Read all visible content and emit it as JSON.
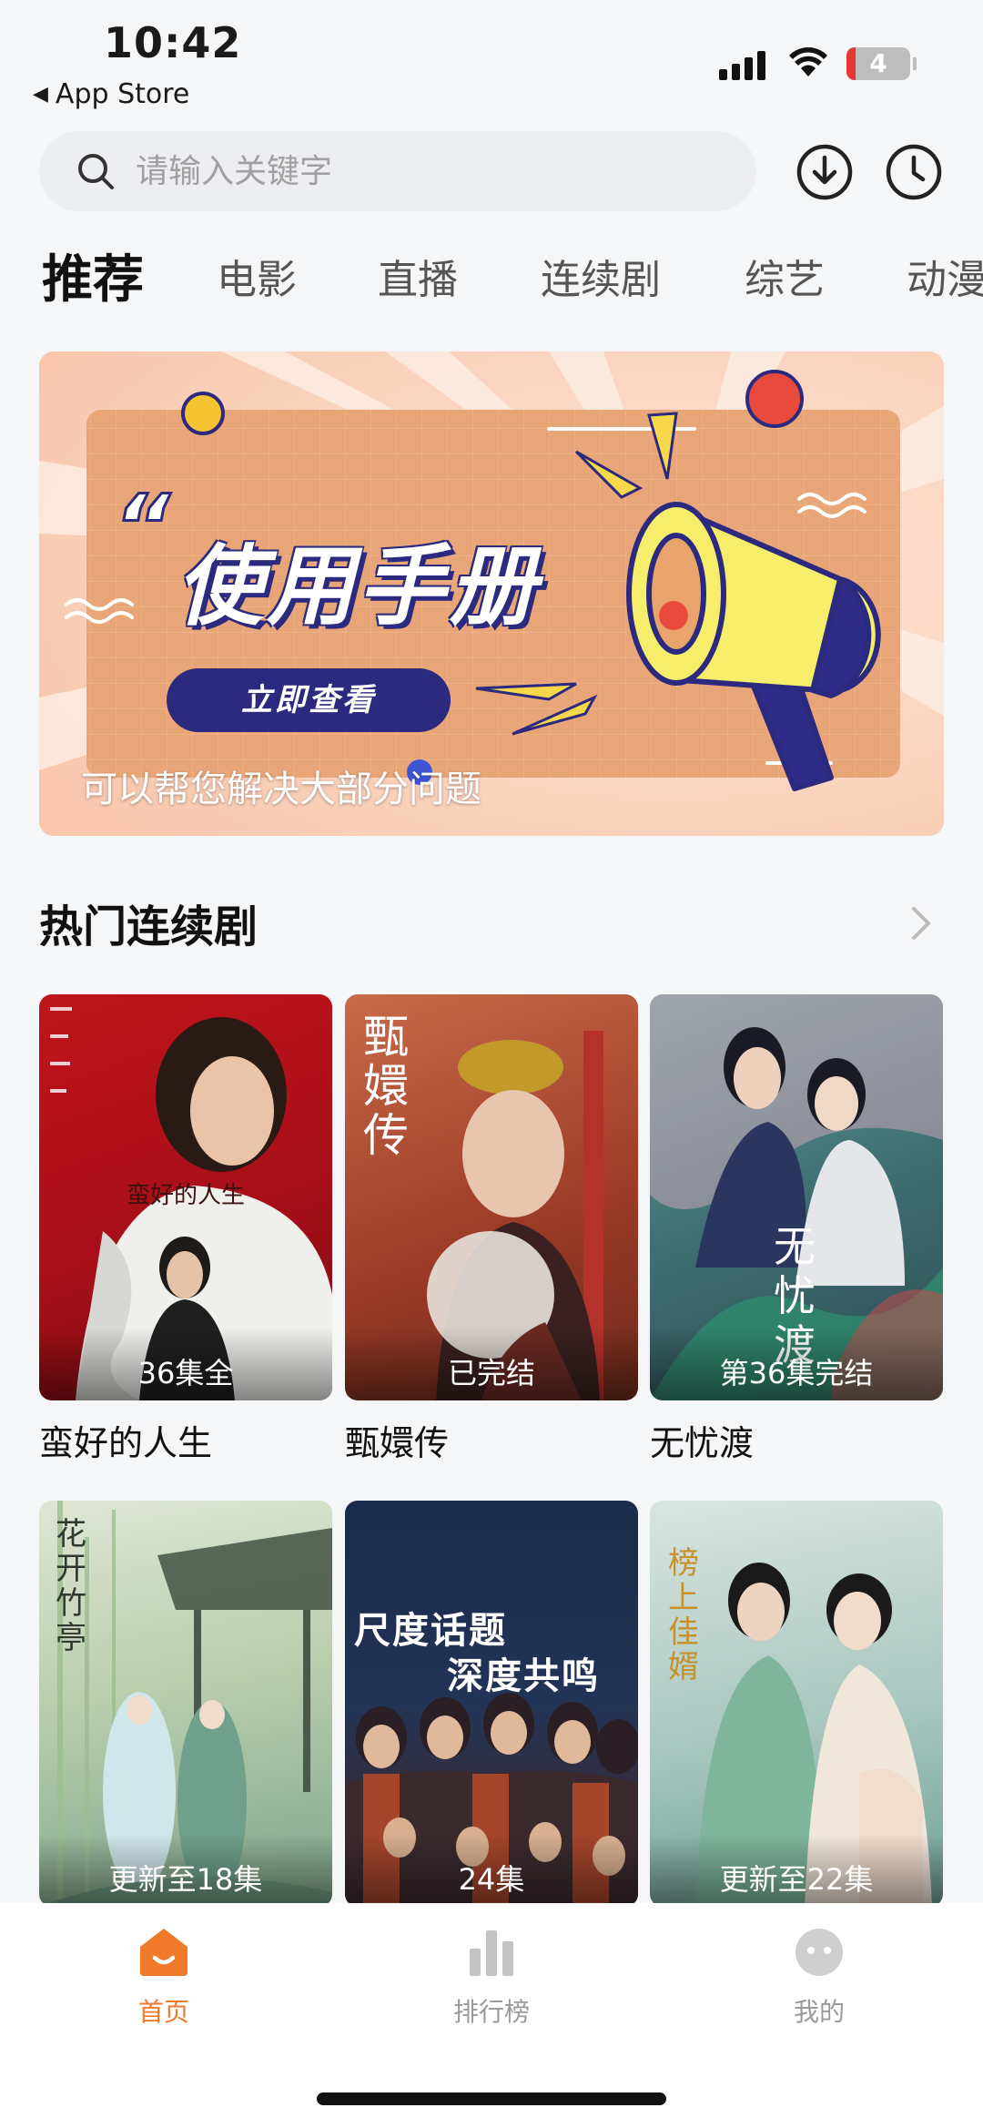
{
  "status_bar": {
    "time": "10:42",
    "back_app": "App Store",
    "battery_level": "4"
  },
  "search": {
    "placeholder": "请输入关键字"
  },
  "tabs": [
    {
      "label": "推荐",
      "active": true
    },
    {
      "label": "电影",
      "active": false
    },
    {
      "label": "直播",
      "active": false
    },
    {
      "label": "连续剧",
      "active": false
    },
    {
      "label": "综艺",
      "active": false
    },
    {
      "label": "动漫",
      "active": false
    }
  ],
  "banner": {
    "headline": "使用手册",
    "button_label": "立即查看",
    "caption": "可以帮您解决大部分问题"
  },
  "section": {
    "title": "热门连续剧"
  },
  "cards": [
    {
      "title": "蛮好的人生",
      "badge": "36集全"
    },
    {
      "title": "甄嬛传",
      "badge": "已完结"
    },
    {
      "title": "无忧渡",
      "badge": "第36集完结"
    },
    {
      "title": "",
      "badge": "更新至18集"
    },
    {
      "title": "",
      "badge": "24集"
    },
    {
      "title": "",
      "badge": "更新至22集"
    }
  ],
  "poster_texts": {
    "card1": "蛮好的人生",
    "card2": "甄嬛传",
    "card3": "无忧渡",
    "card4": "花开竹亭",
    "card5_line1": "尺度话题",
    "card5_line2": "深度共鸣",
    "card6": "榜上佳婿"
  },
  "bottom_nav": [
    {
      "label": "首页",
      "icon": "home-icon",
      "active": true
    },
    {
      "label": "排行榜",
      "icon": "ranking-icon",
      "active": false
    },
    {
      "label": "我的",
      "icon": "profile-icon",
      "active": false
    }
  ],
  "colors": {
    "accent": "#f07a2a",
    "banner_bg": "#fbd8c6",
    "banner_panel": "#e8a577",
    "banner_button": "#2b2a7e"
  }
}
